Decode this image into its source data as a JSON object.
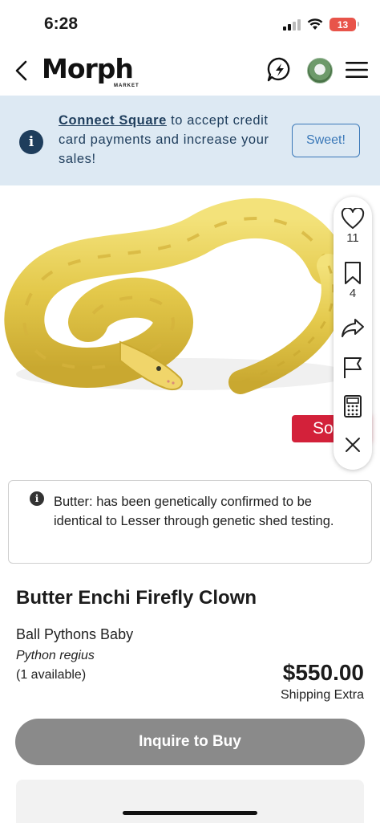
{
  "status_bar": {
    "time": "6:28",
    "battery": "13",
    "icons": [
      "signal-icon",
      "wifi-icon",
      "battery-icon"
    ]
  },
  "nav": {
    "logo_text": "Morph",
    "logo_sub": "MARKET",
    "icons": [
      "back-icon",
      "chat-icon",
      "avatar",
      "menu-icon"
    ]
  },
  "banner": {
    "link_text": "Connect Square",
    "text": " to accept credit card payments and increase your sales!",
    "button_label": "Sweet!",
    "colors": {
      "background": "#dde9f3",
      "text": "#1e3d5c",
      "button": "#3a78b8"
    }
  },
  "photo": {
    "badge_label": "So"
  },
  "actions": {
    "likes_count": "11",
    "saves_count": "4",
    "icons": [
      "heart-icon",
      "bookmark-icon",
      "share-icon",
      "flag-icon",
      "calculator-icon",
      "close-icon"
    ]
  },
  "note": {
    "text": "Butter: has been genetically confirmed to be identical to Lesser through genetic shed testing."
  },
  "listing": {
    "title": "Butter Enchi Firefly Clown",
    "category": "Ball Pythons Baby",
    "species": "Python regius",
    "availability": "(1 available)",
    "price": "$550.00",
    "shipping": "Shipping Extra",
    "cta_label": "Inquire to Buy",
    "colors": {
      "sold": "#d3213a",
      "cta": "#8a8a8a"
    }
  }
}
